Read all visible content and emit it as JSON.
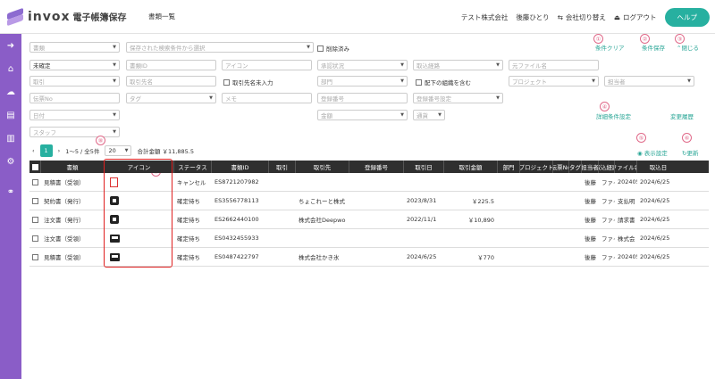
{
  "header": {
    "brand": "invox",
    "brand_sub": "電子帳簿保存",
    "page_title": "書類一覧",
    "company": "テスト株式会社",
    "user": "後藤ひとり",
    "switch_company": "会社切り替え",
    "logout": "ログアウト",
    "help": "ヘルプ"
  },
  "filters": {
    "row1": {
      "doc_type": "書類",
      "saved": "保存された検索条件から選択",
      "deleted": "削除済み"
    },
    "row2": {
      "confirm": "未確定",
      "doc_id": "書類ID",
      "icon": "アイコン",
      "approval": "承認状況",
      "route": "取込経路",
      "source_file": "元ファイル名"
    },
    "row3": {
      "partner": "取引",
      "partner_name": "取引先名",
      "partner_unset": "取引先名未入力",
      "dept": "部門",
      "sub_org": "配下の組織を含む",
      "project": "プロジェクト",
      "assignee": "担当者"
    },
    "row4": {
      "voucher": "伝票No",
      "tag": "タグ",
      "memo": "メモ",
      "reg_no": "登録番号",
      "reg_setting": "登録番号設定"
    },
    "row5": {
      "date": "日付",
      "amount": "金額",
      "currency": "通貨"
    },
    "row6": {
      "staff": "スタッフ"
    }
  },
  "actions": {
    "clear": "条件クリア",
    "save": "条件保存",
    "close": "閉じる",
    "detail": "詳細条件設定",
    "history": "変更履歴",
    "display": "表示設定",
    "refresh": "更新"
  },
  "markers": {
    "m1": "①",
    "m2": "②",
    "m3": "③",
    "m4": "④",
    "m5": "⑤",
    "m6": "⑥",
    "m7": "⑦",
    "m8": "⑧"
  },
  "pager": {
    "current": "1",
    "count": "1〜5 / 全5件",
    "per_page": "20",
    "total": "合計金額 ￥11,885.5"
  },
  "columns": [
    "書類",
    "アイコン",
    "ステータス",
    "書類ID",
    "取引",
    "取引先",
    "登録番号",
    "取引日",
    "取引金額",
    "部門",
    "プロジェクト",
    "伝票No",
    "タグ",
    "担当者",
    "取込経路",
    "ファイル名",
    "取込日"
  ],
  "rows": [
    {
      "type": "見積書（受領）",
      "icon": "pdf-icon",
      "status": "キャンセル",
      "id": "ES8721207982",
      "partner": "",
      "reg": "",
      "date": "",
      "amount": "",
      "assignee": "後藤",
      "route": "ファイ",
      "file": "202405",
      "imported": "2024/6/25"
    },
    {
      "type": "契約書（発行）",
      "icon": "chip-icon",
      "status": "確定待ち",
      "id": "ES3556778113",
      "partner": "ちょこれーと株式",
      "reg": "",
      "date": "2023/8/31",
      "amount": "￥225.5",
      "assignee": "後藤",
      "route": "ファイ",
      "file": "支払明",
      "imported": "2024/6/25"
    },
    {
      "type": "注文書（発行）",
      "icon": "chip-icon",
      "status": "確定待ち",
      "id": "ES2662440100",
      "partner": "株式会社Deepwo",
      "reg": "",
      "date": "2022/11/1",
      "amount": "￥10,890",
      "assignee": "後藤",
      "route": "ファイ",
      "file": "請求書",
      "imported": "2024/6/25"
    },
    {
      "type": "注文書（受領）",
      "icon": "screen-icon",
      "status": "確定待ち",
      "id": "ES0432455933",
      "partner": "",
      "reg": "",
      "date": "",
      "amount": "",
      "assignee": "後藤",
      "route": "ファイ",
      "file": "株式会",
      "imported": "2024/6/25"
    },
    {
      "type": "見積書（受領）",
      "icon": "screen-icon",
      "status": "確定待ち",
      "id": "ES0487422797",
      "partner": "株式会社かき氷",
      "reg": "",
      "date": "2024/6/25",
      "amount": "￥770",
      "assignee": "後藤",
      "route": "ファイ",
      "file": "202405",
      "imported": "2024/6/25"
    }
  ],
  "colors": {
    "accent": "#27b0a0",
    "sidebar": "#8a5dc7",
    "marker": "#e06a8a",
    "highlight": "#e02020"
  }
}
